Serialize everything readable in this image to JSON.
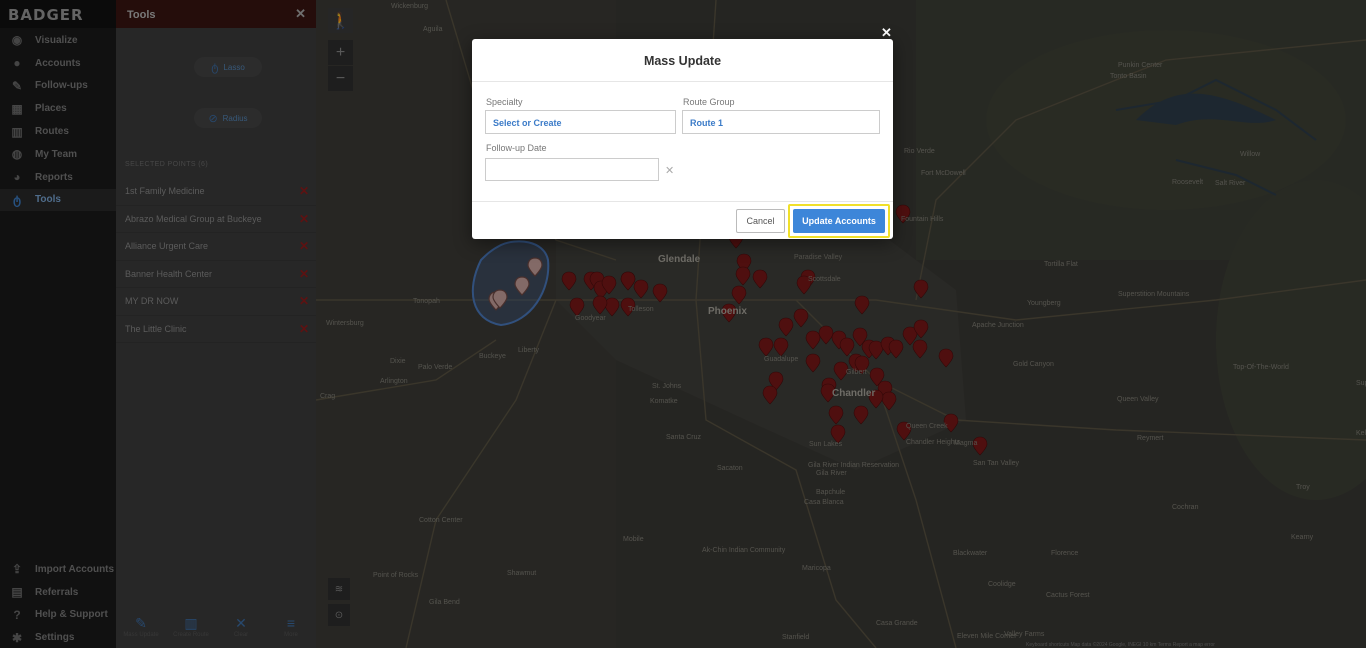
{
  "app": {
    "logo": "BADGER"
  },
  "nav": {
    "items": [
      {
        "label": "Visualize",
        "icon": "eye-icon"
      },
      {
        "label": "Accounts",
        "icon": "user-icon"
      },
      {
        "label": "Follow-ups",
        "icon": "chat-icon"
      },
      {
        "label": "Places",
        "icon": "building-icon"
      },
      {
        "label": "Routes",
        "icon": "map-icon"
      },
      {
        "label": "My Team",
        "icon": "team-icon"
      },
      {
        "label": "Reports",
        "icon": "chart-icon"
      },
      {
        "label": "Tools",
        "icon": "lasso-icon",
        "active": true
      }
    ],
    "bottom": [
      {
        "label": "Import Accounts",
        "icon": "upload-icon"
      },
      {
        "label": "Referrals",
        "icon": "gift-icon"
      },
      {
        "label": "Help & Support",
        "icon": "question-icon"
      },
      {
        "label": "Settings",
        "icon": "gear-icon"
      }
    ]
  },
  "tools": {
    "title": "Tools",
    "lasso_label": "Lasso",
    "radius_label": "Radius",
    "selected_header": "SELECTED POINTS (6)",
    "points": [
      "1st Family Medicine",
      "Abrazo Medical Group at Buckeye",
      "Alliance Urgent Care",
      "Banner Health Center",
      "MY DR NOW",
      "The Little Clinic"
    ],
    "footer": [
      {
        "label": "Mass Update",
        "icon": "user-edit-icon"
      },
      {
        "label": "Create Route",
        "icon": "map-plus-icon"
      },
      {
        "label": "Clear",
        "icon": "close-icon"
      },
      {
        "label": "More",
        "icon": "menu-icon"
      }
    ]
  },
  "map": {
    "labels": [
      {
        "t": "Wickenburg"
      },
      {
        "t": "Aguila"
      },
      {
        "t": "Glendale"
      },
      {
        "t": "Phoenix"
      },
      {
        "t": "Scottsdale"
      },
      {
        "t": "Paradise Valley"
      },
      {
        "t": "Goodyear"
      },
      {
        "t": "Tolleson"
      },
      {
        "t": "Buckeye"
      },
      {
        "t": "Liberty"
      },
      {
        "t": "Wintersburg"
      },
      {
        "t": "Tonopah"
      },
      {
        "t": "Palo Verde"
      },
      {
        "t": "Dixie"
      },
      {
        "t": "Arlington"
      },
      {
        "t": "Crag"
      },
      {
        "t": "St. Johns"
      },
      {
        "t": "Komatke"
      },
      {
        "t": "Guadalupe"
      },
      {
        "t": "Chandler"
      },
      {
        "t": "Gilbert"
      },
      {
        "t": "Queen Creek"
      },
      {
        "t": "Chandler Heights"
      },
      {
        "t": "Magma"
      },
      {
        "t": "San Tan Valley"
      },
      {
        "t": "Sun Lakes"
      },
      {
        "t": "Santa Cruz"
      },
      {
        "t": "Sacaton"
      },
      {
        "t": "Bapchule"
      },
      {
        "t": "Casa Blanca"
      },
      {
        "t": "Gila River Indian Reservation"
      },
      {
        "t": "Maricopa"
      },
      {
        "t": "Mobile"
      },
      {
        "t": "Cotton Center"
      },
      {
        "t": "Shawmut"
      },
      {
        "t": "Point of Rocks"
      },
      {
        "t": "Gila Bend"
      },
      {
        "t": "Ak-Chin Indian Community"
      },
      {
        "t": "Casa Grande"
      },
      {
        "t": "Stanfield"
      },
      {
        "t": "Eleven Mile Corner"
      },
      {
        "t": "Florence"
      },
      {
        "t": "Blackwater"
      },
      {
        "t": "Coolidge"
      },
      {
        "t": "Cactus Forest"
      },
      {
        "t": "Valley Farms"
      },
      {
        "t": "Queen Valley"
      },
      {
        "t": "Reymert"
      },
      {
        "t": "Troy"
      },
      {
        "t": "Cochran"
      },
      {
        "t": "Kearny"
      },
      {
        "t": "Gold Canyon"
      },
      {
        "t": "Apache Junction"
      },
      {
        "t": "Youngberg"
      },
      {
        "t": "Tortilla Flat"
      },
      {
        "t": "Superstition Mountains"
      },
      {
        "t": "Rio Verde"
      },
      {
        "t": "Fort McDowell"
      },
      {
        "t": "Fountain Hills"
      },
      {
        "t": "Roosevelt"
      },
      {
        "t": "Willow"
      },
      {
        "t": "Punkin Center"
      },
      {
        "t": "Tonto Basin"
      },
      {
        "t": "Top-Of-The-World"
      },
      {
        "t": "Superior"
      },
      {
        "t": "Kelvin"
      },
      {
        "t": "Salt River"
      },
      {
        "t": "Gila River"
      }
    ],
    "zoom_in": "+",
    "zoom_out": "−",
    "footer": "Keyboard shortcuts   Map data ©2024 Google, INEGI   10 km   Terms   Report a map error"
  },
  "modal": {
    "title": "Mass Update",
    "specialty_label": "Specialty",
    "specialty_value": "Select or Create",
    "route_group_label": "Route Group",
    "route_group_value": "Route 1",
    "followup_label": "Follow-up Date",
    "followup_value": "",
    "cancel_label": "Cancel",
    "update_label": "Update Accounts",
    "highlight_color": "#f0e02a",
    "accent_color": "#3d86d9"
  }
}
